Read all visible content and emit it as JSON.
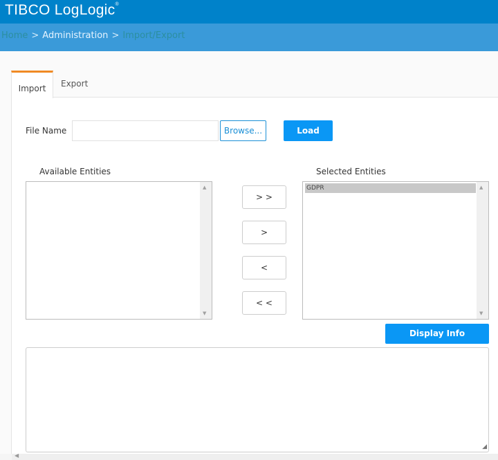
{
  "header": {
    "logo": "TIBCO LogLogic",
    "logo_mark": "®"
  },
  "breadcrumb": {
    "home": "Home",
    "sep": ">",
    "admin": "Administration",
    "current": "Import/Export"
  },
  "tabs": [
    {
      "label": "Import"
    },
    {
      "label": "Export"
    }
  ],
  "form": {
    "file_name_label": "File Name",
    "file_name_value": "",
    "browse_label": "Browse...",
    "load_label": "Load"
  },
  "available": {
    "label": "Available Entities",
    "items": []
  },
  "selected": {
    "label": "Selected Entities",
    "items": [
      "GDPR"
    ]
  },
  "move_buttons": {
    "all_right": "> >",
    "right": ">",
    "left": "<",
    "all_left": "< <"
  },
  "display_info_label": "Display Info",
  "info_text": ""
}
